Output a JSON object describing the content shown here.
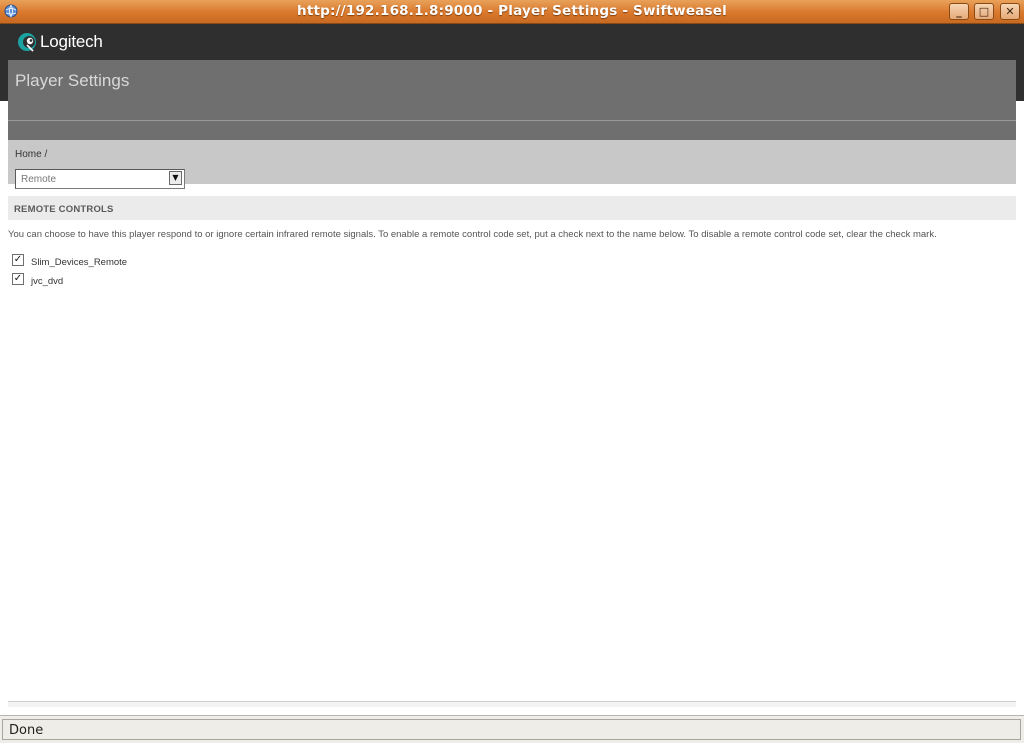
{
  "window": {
    "title": "http://192.168.1.8:9000 - Player Settings - Swiftweasel",
    "app_icon": "browser-globe-icon",
    "controls": {
      "minimize": "_",
      "maximize": "□",
      "close": "✕"
    }
  },
  "header": {
    "logo_text": "Logitech",
    "logo_icon": "logitech-logo-icon",
    "page_title": "Player Settings"
  },
  "breadcrumb": {
    "text": "Home /"
  },
  "settings_select": {
    "value": "Remote"
  },
  "section": {
    "title": "REMOTE CONTROLS",
    "description": "You can choose to have this player respond to or ignore certain infrared remote signals. To enable a remote control code set, put a check next to the name below. To disable a remote control code set, clear the check mark."
  },
  "remotes": [
    {
      "name": "Slim_Devices_Remote",
      "checked": true
    },
    {
      "name": "jvc_dvd",
      "checked": true
    }
  ],
  "statusbar": {
    "text": "Done"
  },
  "colors": {
    "titlebar_accent": "#d9782c",
    "header_dark": "#2f2f2f",
    "panel_gray": "#6f6f6f",
    "logo_teal": "#1aa3a1"
  }
}
